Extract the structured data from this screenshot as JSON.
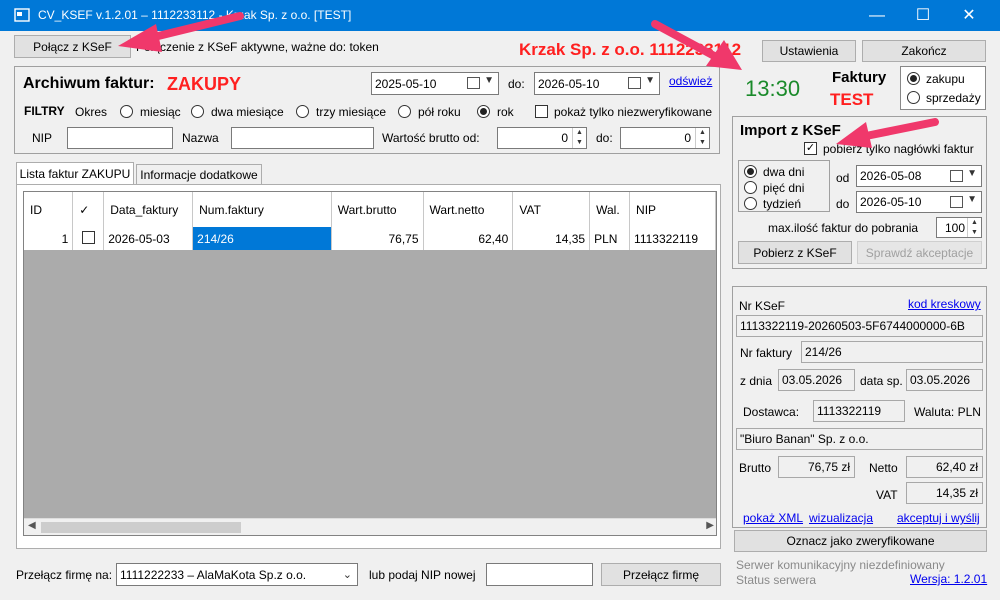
{
  "window": {
    "title": "CV_KSEF v.1.2.01 – 1112233112 - Krzak Sp. z o.o. [TEST]",
    "minimize": "—",
    "maximize": "☐",
    "close": "✕"
  },
  "topbar": {
    "connect_button": "Połącz z KSeF",
    "connection_status": "Połączenie z KSeF aktywne, ważne do: token",
    "company_banner": "Krzak Sp. z o.o. 1112233112",
    "settings_button": "Ustawienia",
    "exit_button": "Zakończ"
  },
  "archive": {
    "title": "Archiwum faktur:",
    "kind": "ZAKUPY",
    "date_from": "2025-05-10",
    "do_label": "do:",
    "date_to": "2026-05-10",
    "refresh_link": "odśwież",
    "filters_label": "FILTRY",
    "period_label": "Okres",
    "periods": [
      "miesiąc",
      "dwa miesiące",
      "trzy miesiące",
      "pół roku",
      "rok"
    ],
    "selected_period": "rok",
    "unverified_only": "pokaż tylko niezweryfikowane",
    "nip_label": "NIP",
    "nip_value": "",
    "name_label": "Nazwa",
    "name_value": "",
    "gross_from_label": "Wartość brutto od:",
    "gross_from": "0",
    "gross_to_label": "do:",
    "gross_to": "0"
  },
  "clock": "13:30",
  "invoices_panel": {
    "title": "Faktury",
    "mode": "TEST",
    "options": [
      "zakupu",
      "sprzedaży"
    ],
    "selected": "zakupu"
  },
  "tabs": [
    "Lista faktur ZAKUPU",
    "Informacje dodatkowe"
  ],
  "table": {
    "columns": [
      "ID",
      "✓",
      "Data_faktury",
      "Num.faktury",
      "Wart.brutto",
      "Wart.netto",
      "VAT",
      "Wal.",
      "NIP"
    ],
    "rows": [
      {
        "id": "1",
        "checked": false,
        "date": "2026-05-03",
        "number": "214/26",
        "gross": "76,75",
        "net": "62,40",
        "vat": "14,35",
        "currency": "PLN",
        "nip": "1113322119"
      }
    ]
  },
  "import": {
    "title": "Import z KSeF",
    "headers_only": "pobierz tylko nagłówki faktur",
    "ranges": [
      "dwa dni",
      "pięć dni",
      "tydzień"
    ],
    "selected_range": "dwa dni",
    "od_label": "od",
    "date_from": "2026-05-08",
    "do_label": "do",
    "date_to": "2026-05-10",
    "max_label": "max.ilość faktur do pobrania",
    "max_value": "100",
    "fetch_button": "Pobierz z KSeF",
    "check_button": "Sprawdź akceptacje"
  },
  "details": {
    "nr_ksef_label": "Nr KSeF",
    "barcode_link": "kod kreskowy",
    "nr_ksef": "1113322119-20260503-5F6744000000-6B",
    "nr_faktury_label": "Nr faktury",
    "nr_faktury": "214/26",
    "z_dnia_label": "z dnia",
    "z_dnia": "03.05.2026",
    "data_sp_label": "data sp.",
    "data_sp": "03.05.2026",
    "supplier_label": "Dostawca:",
    "supplier_nip": "1113322119",
    "currency_label": "Waluta: PLN",
    "supplier_name": "\"Biuro Banan\" Sp. z o.o.",
    "brutto_label": "Brutto",
    "brutto": "76,75 zł",
    "netto_label": "Netto",
    "netto": "62,40 zł",
    "vat_label": "VAT",
    "vat": "14,35 zł",
    "xml_link": "pokaż XML",
    "viz_link": "wizualizacja",
    "accept_link": "akceptuj i wyślij"
  },
  "mark_verified_button": "Oznacz jako zweryfikowane",
  "footer": {
    "switch_label": "Przełącz firmę na:",
    "company_select": "1111222233 – AlaMaKota Sp.z o.o.",
    "nip_label": "lub podaj NIP nowej",
    "nip_value": "",
    "switch_button": "Przełącz firmę",
    "server_status": "Serwer komunikacyjny niezdefiniowany",
    "server_label": "Status serwera",
    "version_link": "Wersja: 1.2.01"
  },
  "colors": {
    "titlebar": "#0078d7",
    "accent_red": "#ff2020",
    "clock_green": "#1a8a2a",
    "selection_blue": "#0078d7",
    "arrow_pink": "#f0386b"
  }
}
